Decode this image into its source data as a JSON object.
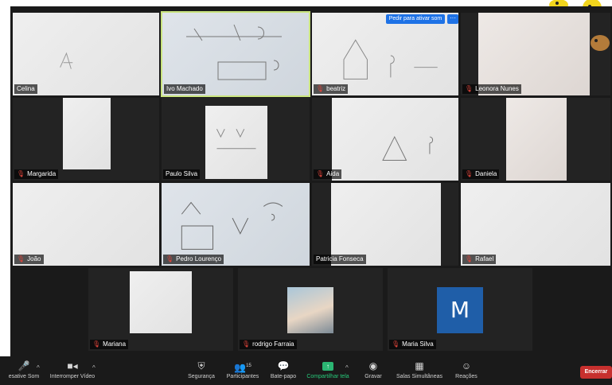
{
  "participants": [
    {
      "name": "Celina",
      "muted": false
    },
    {
      "name": "Ivo Machado",
      "muted": false,
      "active_speaker": true
    },
    {
      "name": "beatriz",
      "muted": true
    },
    {
      "name": "Leonora Nunes",
      "muted": true
    },
    {
      "name": "Margarida",
      "muted": true
    },
    {
      "name": "Paulo Silva",
      "muted": false
    },
    {
      "name": "Aida",
      "muted": true
    },
    {
      "name": "Daniela",
      "muted": true
    },
    {
      "name": "João",
      "muted": true
    },
    {
      "name": "Pedro Lourenço",
      "muted": true
    },
    {
      "name": "Patricia Fonseca",
      "muted": false
    },
    {
      "name": "Rafael",
      "muted": true
    },
    {
      "name": "Mariana",
      "muted": true
    },
    {
      "name": "rodrigo Farraia",
      "muted": true
    },
    {
      "name": "Maria Silva",
      "muted": true
    }
  ],
  "avatar_letter": "M",
  "request_unmute": {
    "label": "Pedir para ativar som",
    "more": "···"
  },
  "toolbar": {
    "unmute": "esative Som",
    "stop_video": "Interromper Vídeo",
    "security": "Segurança",
    "participants": "Participantes",
    "participants_count": "15",
    "chat": "Bate-papo",
    "share": "Compartilhar tela",
    "record": "Gravar",
    "breakout": "Salas Simultâneas",
    "reactions": "Reações",
    "end": "Encerrar"
  },
  "colors": {
    "active_border": "#c9e47d",
    "share_green": "#27c97a",
    "end_red": "#c7302e",
    "avatar_blue": "#1f5ea8",
    "request_blue": "#1e72e6",
    "mute_red": "#e2453b"
  },
  "icons": {
    "mic": "microphone-icon",
    "video": "video-camera-icon",
    "security": "shield-icon",
    "participants": "people-icon",
    "chat": "chat-bubble-icon",
    "share": "share-screen-icon",
    "record": "record-icon",
    "breakout": "grid-icon",
    "reactions": "smiley-add-icon"
  }
}
